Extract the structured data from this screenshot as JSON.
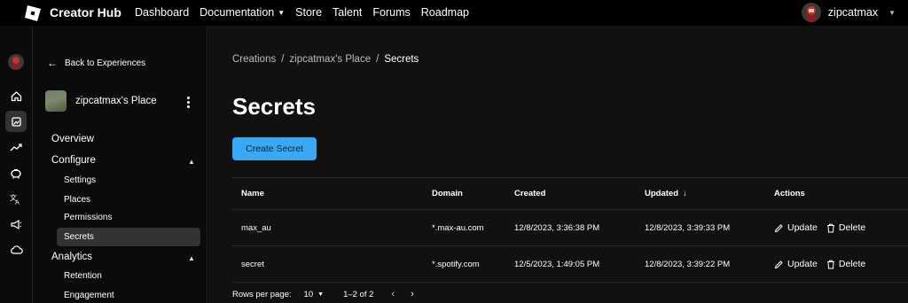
{
  "header": {
    "brand": "Creator Hub",
    "nav": [
      {
        "label": "Dashboard"
      },
      {
        "label": "Documentation",
        "has_dropdown": true
      },
      {
        "label": "Store"
      },
      {
        "label": "Talent"
      },
      {
        "label": "Forums"
      },
      {
        "label": "Roadmap"
      }
    ],
    "username": "zipcatmax"
  },
  "rail": {
    "icons": [
      "avatar",
      "home-icon",
      "creations-icon",
      "analytics-icon",
      "monetization-icon",
      "localization-icon",
      "marketing-icon",
      "cloud-icon"
    ],
    "active": "creations-icon"
  },
  "sidebar": {
    "back_label": "Back to Experiences",
    "experience_name": "zipcatmax's Place",
    "overview": "Overview",
    "configure": "Configure",
    "configure_items": [
      "Settings",
      "Places",
      "Permissions",
      "Secrets"
    ],
    "active_item": "Secrets",
    "analytics": "Analytics",
    "analytics_items": [
      "Retention",
      "Engagement"
    ]
  },
  "main": {
    "breadcrumb": [
      "Creations",
      "zipcatmax's Place",
      "Secrets"
    ],
    "title": "Secrets",
    "create_button": "Create Secret",
    "table": {
      "columns": [
        "Name",
        "Domain",
        "Created",
        "Updated",
        "Actions"
      ],
      "sorted_column": "Updated",
      "rows": [
        {
          "name": "max_au",
          "domain": "*.max-au.com",
          "created": "12/8/2023, 3:36:38 PM",
          "updated": "12/8/2023, 3:39:33 PM"
        },
        {
          "name": "secret",
          "domain": "*.spotify.com",
          "created": "12/5/2023, 1:49:05 PM",
          "updated": "12/8/2023, 3:39:22 PM"
        }
      ],
      "update_label": "Update",
      "delete_label": "Delete"
    },
    "pagination": {
      "rows_per_page_label": "Rows per page:",
      "rows_per_page": "10",
      "range": "1–2 of 2"
    }
  },
  "colors": {
    "accent": "#39a8f5",
    "background": "#111111",
    "sidebar": "#0b0b0b",
    "active_item": "#333333"
  }
}
